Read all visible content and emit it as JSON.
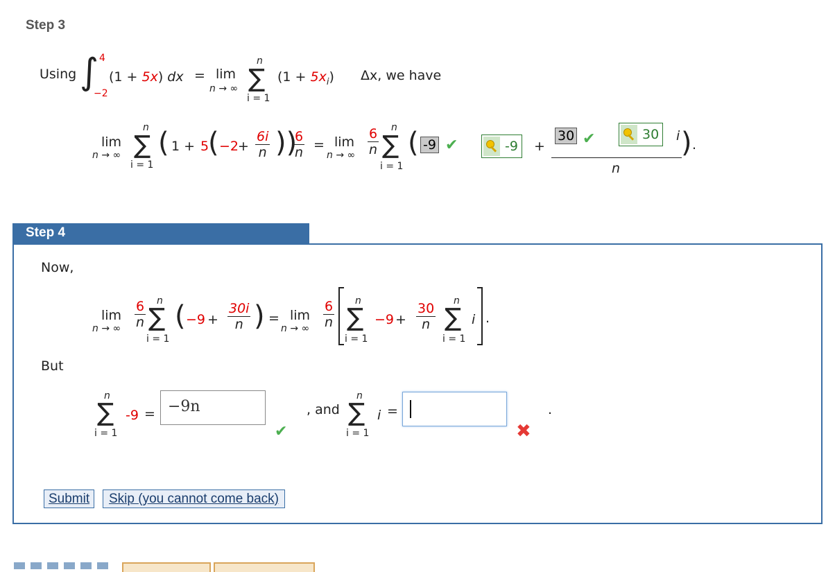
{
  "step3": {
    "title": "Step 3",
    "using": "Using",
    "integral": {
      "upper": "4",
      "lower": "−2",
      "integrand_open": "(1 + ",
      "coef": "5x",
      "integrand_close": ")",
      "dx": " dx",
      "eq": "="
    },
    "limit": {
      "lim": "lim",
      "sub": "n → ∞"
    },
    "sum": {
      "sigma": "∑",
      "top": "n",
      "bottom": "i = 1"
    },
    "term_open": "(1 + ",
    "term_coef": "5x",
    "term_sub": "i",
    "term_close": ")",
    "delta": "Δx, we have",
    "line2": {
      "one_plus": "1 + ",
      "five": "5",
      "minus2": "−2",
      "plus": " + ",
      "frac1_num": "6i",
      "frac1_den": "n",
      "frac2_num": "6",
      "frac2_den": "n",
      "eq": "=",
      "frac3_num": "6",
      "frac3_den": "n",
      "answer1": "-9",
      "answer1_key": "-9",
      "plus2": "+",
      "answer2": "30",
      "answer2_key": "30",
      "i_var": "i",
      "frac4_den": "n",
      "end": "."
    }
  },
  "step4": {
    "title": "Step 4",
    "now": "Now,",
    "eq_line": {
      "frac_num": "6",
      "frac_den": "n",
      "minus9": "−9",
      "plus": " + ",
      "frac2_num": "30i",
      "frac2_den": "n",
      "eq": "=",
      "frac3_num": "6",
      "frac3_den": "n",
      "minus9_b": "−9",
      "plus_b": " + ",
      "frac4_num": "30",
      "frac4_den": "n",
      "i_var": "i",
      "end": "."
    },
    "but": "But",
    "sum_line": {
      "term": "-9",
      "eq": "=",
      "input1_value": "−9n",
      "and": ", and",
      "i_var": "i",
      "eq2": "=",
      "input2_value": "",
      "end": "."
    },
    "submit": "Submit",
    "skip": "Skip (you cannot come back)"
  },
  "colors": {
    "accent": "#3a6ea5",
    "red": "#e00000",
    "green": "#4caf50",
    "key_green": "#2e7d32"
  }
}
